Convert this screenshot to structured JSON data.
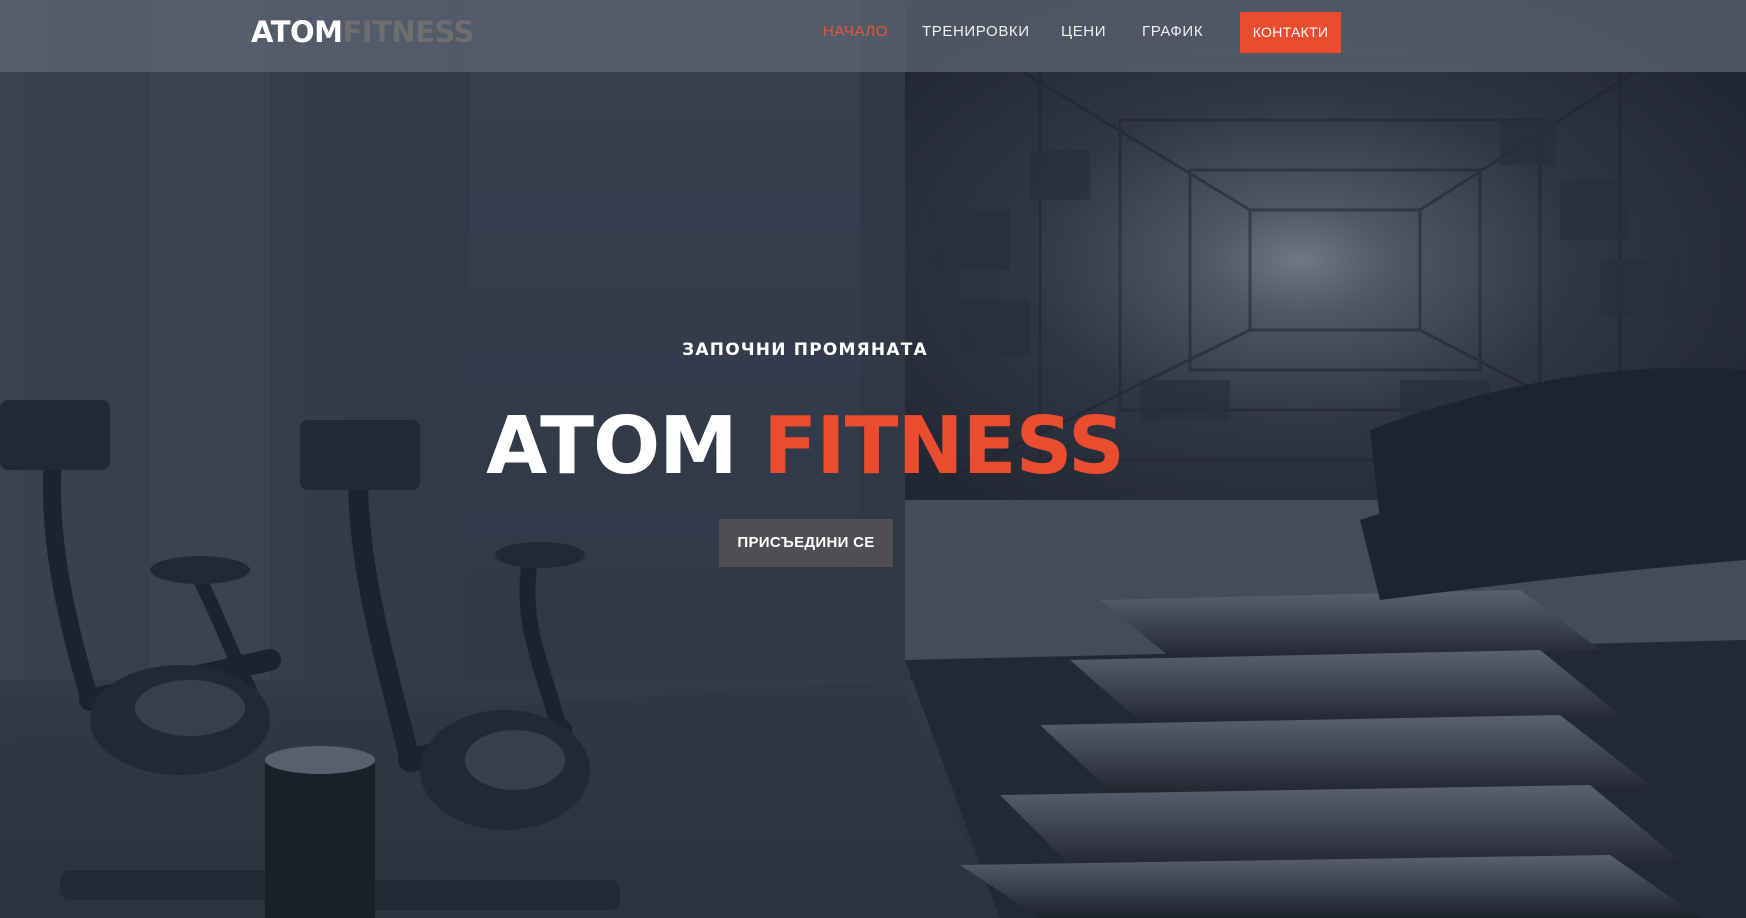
{
  "header": {
    "logo": {
      "part1": "ATOM",
      "part2": "FITNESS"
    },
    "nav": [
      {
        "label": "НАЧАЛО",
        "active": true
      },
      {
        "label": "ТРЕНИРОВКИ",
        "active": false
      },
      {
        "label": "ЦЕНИ",
        "active": false
      },
      {
        "label": "ГРАФИК",
        "active": false
      }
    ],
    "contact_button": "КОНТАКТИ"
  },
  "hero": {
    "tagline": "ЗАПОЧНИ ПРОМЯНАТА",
    "title_part1": "ATOM",
    "title_part2": "FITNESS",
    "join_button": "ПРИСЪЕДИНИ СЕ"
  },
  "colors": {
    "accent": "#ea4c2f",
    "header_bg": "#5f6674",
    "button_dark": "#4f4e52"
  }
}
